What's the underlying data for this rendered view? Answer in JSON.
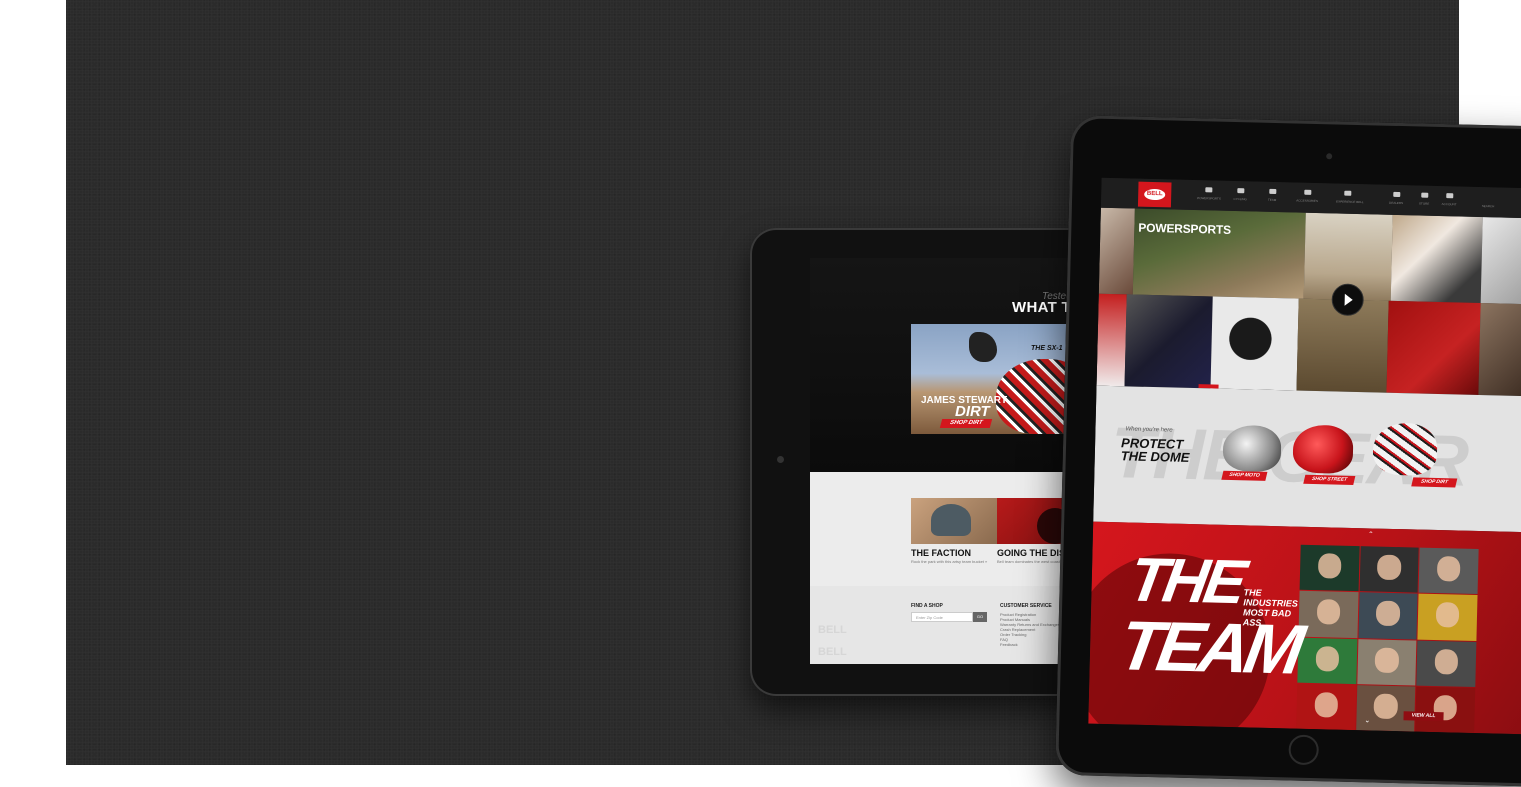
{
  "colors": {
    "brand_red": "#d4161d",
    "stage_bg": "#2b2b2b"
  },
  "landscape_screen": {
    "tagline": "Tested by t",
    "headline": "WHAT THE",
    "hero": {
      "helmet_label": "THE SX-1",
      "rider": "JAMES STEWART",
      "category": "DIRT",
      "shop_button": "SHOP DIRT"
    },
    "features": [
      {
        "title": "THE FACTION",
        "desc": "Rock the park with this artsy team bucket »"
      },
      {
        "title": "GOING THE DISTANCE",
        "desc": "Bell team dominates the west coast's Death Ride"
      }
    ],
    "footer": {
      "find_title": "FIND A SHOP",
      "zip_placeholder": "Enter Zip Code",
      "go_label": "GO",
      "cs_title": "CUSTOMER SERVICE",
      "cs_items": [
        "Product Registration",
        "Product Manuals",
        "Warranty Returns and Exchanges",
        "Crash Replacement",
        "Order Tracking",
        "FAQ",
        "Feedback"
      ],
      "watermarks": [
        "BELL",
        "BELL"
      ]
    }
  },
  "portrait_screen": {
    "logo": "BELL",
    "nav": [
      {
        "label": "POWERSPORTS",
        "icon": "helmet-icon"
      },
      {
        "label": "CYCLING",
        "icon": "bicycle-icon"
      },
      {
        "label": "TEAM",
        "icon": "team-icon"
      },
      {
        "label": "ACCESSORIES",
        "icon": "goggles-icon"
      },
      {
        "label": "EXPERIENCE BELL",
        "icon": "video-icon"
      },
      {
        "label": "DEALERS",
        "icon": "pin-icon"
      },
      {
        "label": "STORE",
        "icon": "cart-icon"
      },
      {
        "label": "ACCOUNT",
        "icon": "user-icon"
      },
      {
        "label": "SEARCH",
        "icon": "search-icon"
      }
    ],
    "hero_title": "POWERSPORTS",
    "gear": {
      "background_text": "THE GEAR",
      "kicker": "When you're here",
      "headline": "PROTECT THE DOME",
      "buttons": [
        "SHOP MOTO",
        "SHOP STREET",
        "SHOP DIRT"
      ]
    },
    "team": {
      "the": "THE",
      "team": "TEAM",
      "subtitle": "THE INDUSTRIES MOST BAD ASS",
      "view_all": "VIEW ALL"
    }
  }
}
